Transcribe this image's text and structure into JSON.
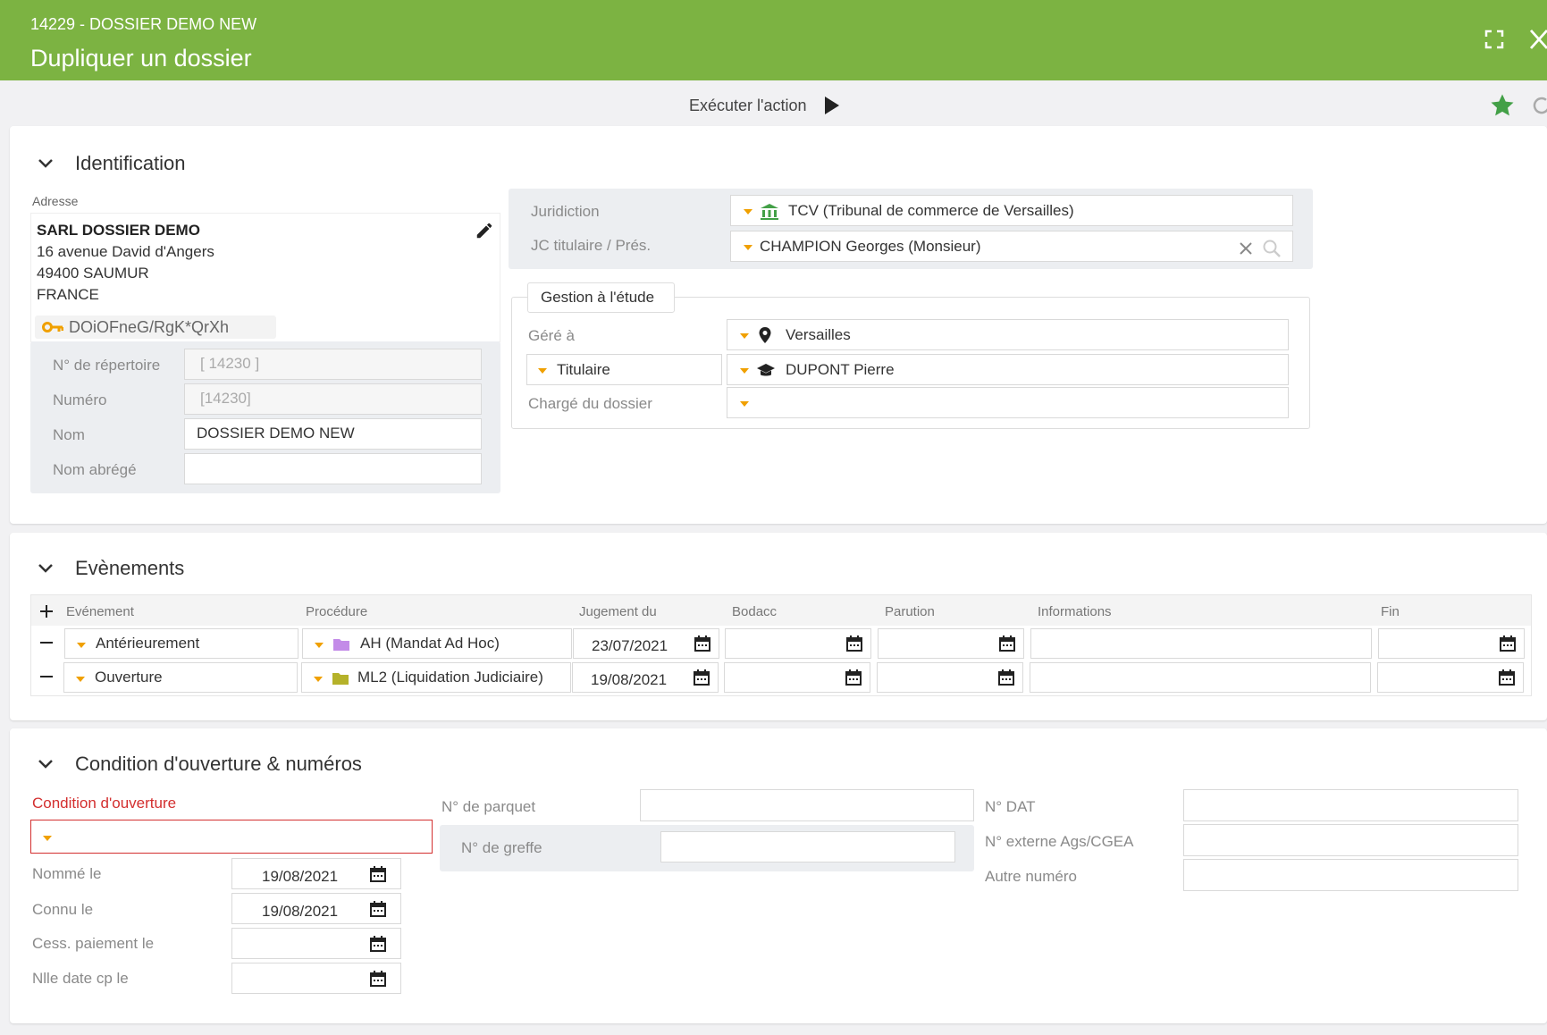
{
  "header": {
    "subtitle": "14229 - DOSSIER DEMO NEW",
    "title": "Dupliquer un dossier"
  },
  "toolbar": {
    "execute_label": "Exécuter l'action"
  },
  "identification": {
    "title": "Identification",
    "address_label": "Adresse",
    "address_lines": [
      "SARL DOSSIER DEMO",
      "16 avenue David d'Angers",
      "49400 SAUMUR",
      "FRANCE"
    ],
    "key_code": "DOiOFneG/RgK*QrXh",
    "repertoire_label": "N° de répertoire",
    "repertoire_value": "[ 14230 ]",
    "numero_label": "Numéro",
    "numero_value": "[14230]",
    "nom_label": "Nom",
    "nom_value": "DOSSIER DEMO NEW",
    "nom_abrege_label": "Nom abrégé",
    "nom_abrege_value": "",
    "juridiction_label": "Juridiction",
    "juridiction_value": "TCV (Tribunal de commerce de Versailles)",
    "jc_label": "JC titulaire / Prés.",
    "jc_value": "CHAMPION Georges (Monsieur)",
    "gestion_tab": "Gestion à l'étude",
    "gere_label": "Géré à",
    "gere_value": "Versailles",
    "titulaire_label": "Titulaire",
    "titulaire_value": "DUPONT Pierre",
    "charge_label": "Chargé du dossier",
    "charge_value": ""
  },
  "events": {
    "title": "Evènements",
    "columns": [
      "Evénement",
      "Procédure",
      "Jugement du",
      "Bodacc",
      "Parution",
      "Informations",
      "Fin"
    ],
    "rows": [
      {
        "event": "Antérieurement",
        "procedure": "AH (Mandat Ad Hoc)",
        "jugement": "23/07/2021",
        "folder_color": "#c38be8"
      },
      {
        "event": "Ouverture",
        "procedure": "ML2 (Liquidation Judiciaire)",
        "jugement": "19/08/2021",
        "folder_color": "#b5b22a"
      }
    ]
  },
  "condition": {
    "title": "Condition d'ouverture & numéros",
    "condition_label": "Condition d'ouverture",
    "nomme_label": "Nommé le",
    "nomme_value": "19/08/2021",
    "connu_label": "Connu le",
    "connu_value": "19/08/2021",
    "cess_label": "Cess. paiement le",
    "cess_value": "",
    "nlle_label": "Nlle date cp le",
    "nlle_value": "",
    "parquet_label": "N° de parquet",
    "greffe_label": "N° de greffe",
    "dat_label": "N° DAT",
    "ags_label": "N° externe Ags/CGEA",
    "autre_label": "Autre numéro"
  },
  "colors": {
    "brand": "#7cb342",
    "accent": "#f0a000",
    "error": "#d32f2f",
    "star": "#43a047"
  }
}
